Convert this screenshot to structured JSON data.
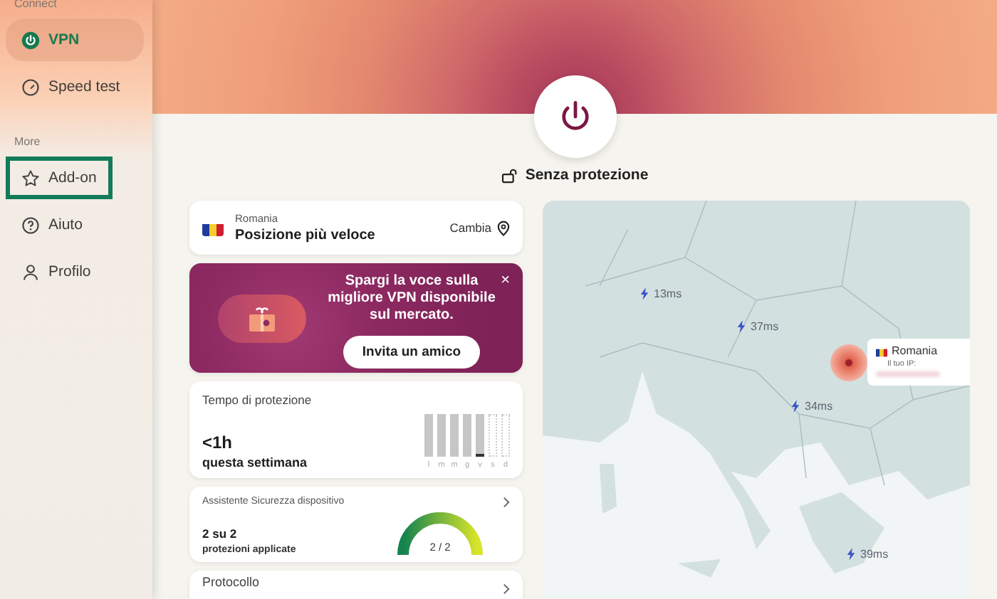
{
  "sidebar": {
    "sections": [
      {
        "label": "Connect",
        "items": [
          {
            "label": "VPN",
            "selected": true,
            "highlighted": false
          },
          {
            "label": "Speed test",
            "selected": false,
            "highlighted": false
          }
        ]
      },
      {
        "label": "More",
        "items": [
          {
            "label": "Add-on",
            "selected": false,
            "highlighted": true
          },
          {
            "label": "Aiuto",
            "selected": false,
            "highlighted": false
          },
          {
            "label": "Profilo",
            "selected": false,
            "highlighted": false
          }
        ]
      }
    ]
  },
  "connection": {
    "connected": false,
    "status": "Senza protezione"
  },
  "location": {
    "country": "Romania",
    "server": "Posizione più veloce",
    "action": "Cambia"
  },
  "promo": {
    "text": "Spargi la voce sulla migliore VPN disponibile sul mercato.",
    "button": "Invita un amico",
    "close": "×"
  },
  "protection_time": {
    "title": "Tempo di protezione",
    "value": "<1h",
    "caption": "questa settimana",
    "days": [
      {
        "label": "l",
        "kind": "past",
        "selected": false
      },
      {
        "label": "m",
        "kind": "past",
        "selected": false
      },
      {
        "label": "m",
        "kind": "past",
        "selected": false
      },
      {
        "label": "g",
        "kind": "past",
        "selected": false
      },
      {
        "label": "v",
        "kind": "past",
        "selected": true
      },
      {
        "label": "s",
        "kind": "future",
        "selected": false
      },
      {
        "label": "d",
        "kind": "future",
        "selected": false
      }
    ]
  },
  "security_assistant": {
    "title": "Assistente Sicurezza dispositivo",
    "count": "2 su 2",
    "caption": "protezioni applicate",
    "gauge_label": "2 / 2",
    "level": 1
  },
  "protocol": {
    "title": "Protocollo"
  },
  "map": {
    "location": {
      "country": "Romania",
      "caption": "Il tuo IP:"
    },
    "servers": [
      {
        "ping": "13ms"
      },
      {
        "ping": "37ms"
      },
      {
        "ping": "34ms"
      },
      {
        "ping": "39ms"
      }
    ]
  }
}
